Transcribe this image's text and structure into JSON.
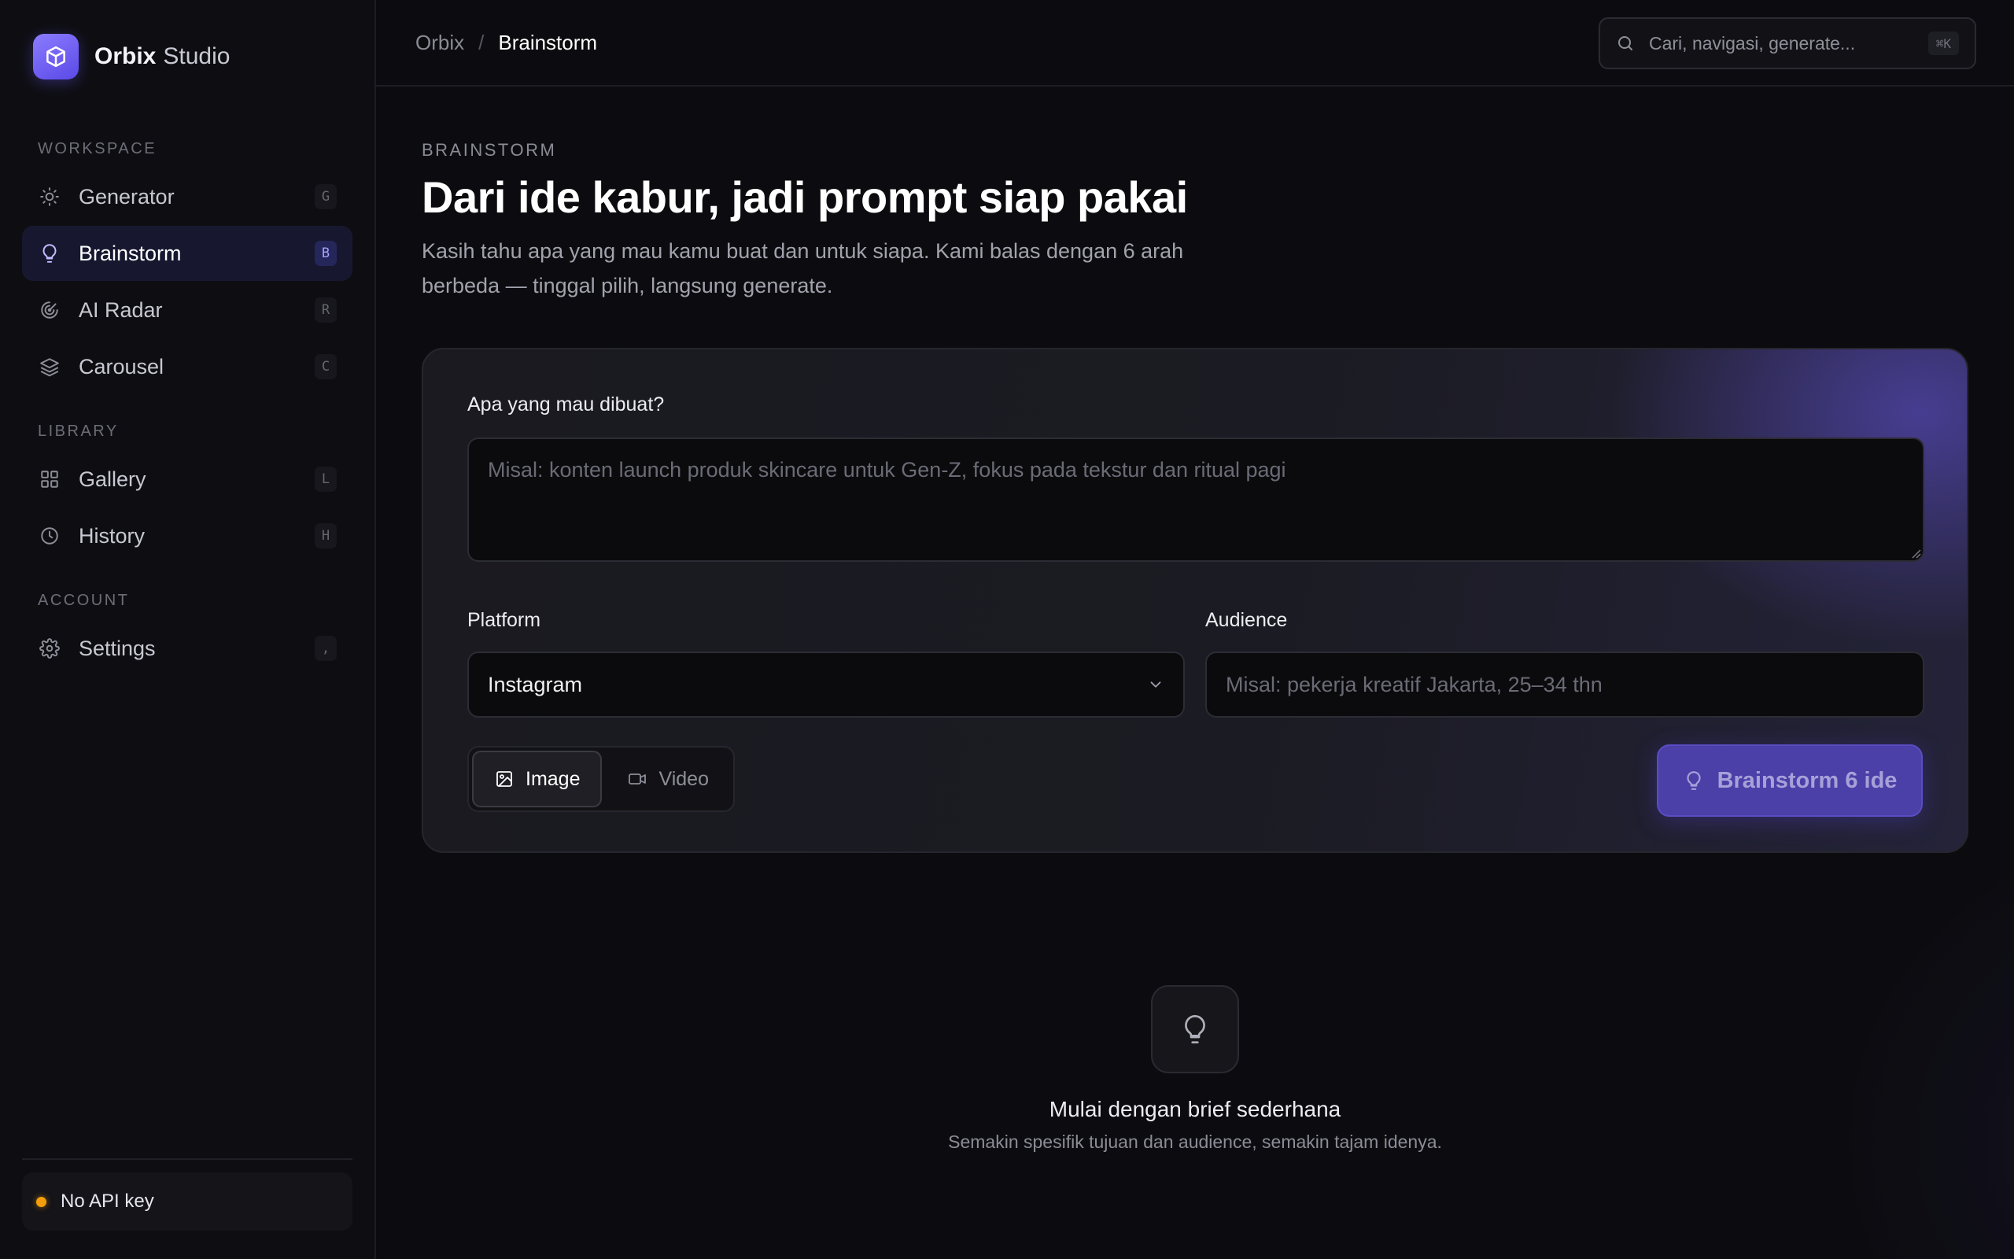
{
  "brand": {
    "name": "Orbix",
    "sub": "Studio"
  },
  "sidebar": {
    "sections": [
      {
        "label": "WORKSPACE"
      },
      {
        "label": "LIBRARY"
      },
      {
        "label": "ACCOUNT"
      }
    ],
    "items": [
      {
        "label": "Generator",
        "key": "G",
        "icon": "sun-icon"
      },
      {
        "label": "Brainstorm",
        "key": "B",
        "icon": "lightbulb-icon",
        "active": true
      },
      {
        "label": "AI Radar",
        "key": "R",
        "icon": "radar-icon"
      },
      {
        "label": "Carousel",
        "key": "C",
        "icon": "layers-icon"
      },
      {
        "label": "Gallery",
        "key": "L",
        "icon": "grid-icon"
      },
      {
        "label": "History",
        "key": "H",
        "icon": "clock-icon"
      },
      {
        "label": "Settings",
        "key": ",",
        "icon": "gear-icon"
      }
    ],
    "api_status": {
      "label": "No API key",
      "color": "#f59e0b"
    }
  },
  "topbar": {
    "breadcrumb": {
      "root": "Orbix",
      "separator": "/",
      "current": "Brainstorm"
    },
    "search": {
      "placeholder": "Cari, navigasi, generate...",
      "shortcut": "⌘K"
    }
  },
  "main": {
    "eyebrow": "BRAINSTORM",
    "title": "Dari ide kabur, jadi prompt siap pakai",
    "lede": "Kasih tahu apa yang mau kamu buat dan untuk siapa. Kami balas dengan 6 arah berbeda — tinggal pilih, langsung generate."
  },
  "form": {
    "brief_label": "Apa yang mau dibuat?",
    "brief_placeholder": "Misal: konten launch produk skincare untuk Gen-Z, fokus pada tekstur dan ritual pagi",
    "platform_label": "Platform",
    "platform_value": "Instagram",
    "audience_label": "Audience",
    "audience_placeholder": "Misal: pekerja kreatif Jakarta, 25–34 thn",
    "modes": [
      {
        "label": "Image",
        "active": true
      },
      {
        "label": "Video",
        "active": false
      }
    ],
    "submit_label": "Brainstorm 6 ide"
  },
  "empty_state": {
    "title": "Mulai dengan brief sederhana",
    "subtitle": "Semakin spesifik tujuan dan audience, semakin tajam idenya."
  },
  "colors": {
    "accent": "#6b5cf0",
    "background": "#0c0c10",
    "warning": "#f59e0b"
  }
}
